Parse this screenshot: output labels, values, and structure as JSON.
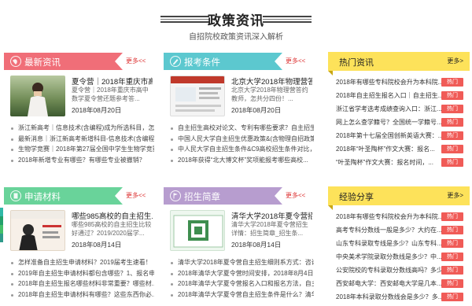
{
  "header": {
    "title": "政策资讯",
    "subtitle": "自招院校政策资讯深入解析"
  },
  "panels": [
    {
      "title": "最新资讯",
      "more": "更多<<",
      "color": "#f06e78",
      "icon": "globe-icon",
      "feature": {
        "title": "夏令营｜2018年重庆市高...",
        "desc": "夏令营｜2018年重庆市高中数学夏令营还题参考答...",
        "date": "2018年08月20日"
      },
      "items": [
        "浙江新高考｜信息技术(含编程)成为所选科目，怎...",
        "最新消息｜浙江新高考新增科目-信息技术(含编程)...",
        "生物学竞赛｜2018年第27届全国中学生生物学竞赛...",
        "2018年新增专业有哪些？有哪些专业被撤销？"
      ]
    },
    {
      "title": "报考条件",
      "more": "更多<<",
      "color": "#5cc8cf",
      "icon": "pencil-icon",
      "feature": {
        "title": "北京大学2018年物理营答...",
        "desc": "北京大学2018年物理营答约教师，怎共分四份！...",
        "date": "2018年08月20日"
      },
      "items": [
        "自主招生高校对论文、专利有哪些要求？自主招生...",
        "中国人民大学自主招生优惠政策&(含物理自招政策)",
        "中人民大学自主招生条件&C9高校招生条件对比，...",
        "2018年获得“北大博文杯”奖项能报考哪些高校..."
      ]
    },
    {
      "title": "申请材料",
      "more": "更多<<",
      "color": "#69d39a",
      "icon": "file-icon",
      "feature": {
        "title": "哪些985高校的自主招生...",
        "desc": "哪些985高校的自主招生比较好通过？2019/2020届学...",
        "date": "2018年08月14日"
      },
      "items": [
        "怎样准备自主招生申请材料？2019届考生速看！",
        "2019年自主招生申请材料都包含哪些？1、报名申...",
        "2018年自主招生报名哪些材料非常重要？哪些材...",
        "2018年自主招生申请材料有哪些？这些东西你必..."
      ]
    },
    {
      "title": "招生简章",
      "more": "更多<<",
      "color": "#b79dcf",
      "icon": "flag-icon",
      "feature": {
        "title": "清华大学2018年夏令营招...",
        "desc": "清华大学2018年夏令营招生详情：招生简章_招生条...",
        "date": "2018年08月14日"
      },
      "items": [
        "清华大学2018年夏令营自主招生细则系方式：咨询电...",
        "2018年清华大学夏令营时间安排，2018年8月4日...",
        "2018年清华大学夏令营报名入口和报名方法，自主...",
        "2018年清华大学夏令营自主招生条件是什么？清华..."
      ]
    }
  ],
  "hot": {
    "title": "热门资讯",
    "more": "更多>",
    "tag": "热门",
    "items": [
      "2018年有哪些专科院校会升为本科院...",
      "2018年自主招生报名入口｜自主招生...",
      "浙江省学考选考成绩查询入口：浙江...",
      "网上怎么查学籍号？全国统一学籍号...",
      "2018年第十七届全国创新英语大赛：...",
      "2018年“叶圣陶杯”作文大赛：报名...",
      "“叶圣陶杯”作文大赛：报名时间，..."
    ]
  },
  "share": {
    "title": "经验分享",
    "more": "更多>",
    "tag": "热门",
    "items": [
      "2018年有哪些专科院校会升为本科院...",
      "高考专科分数线一般是多少？大约在...",
      "山东专科录取专线是多少？山东专科...",
      "中央美术学院录取分数线是多少？中...",
      "公安院校的专科录取分数线高吗？多少...",
      "西安邮电大学：西安邮电大学是几本...",
      "2018年本科录取分数线会是多少？多..."
    ]
  },
  "sidebar_colors": [
    "#2fb8a6",
    "#22a06b",
    "#43c06a",
    "#2e9a8a"
  ]
}
